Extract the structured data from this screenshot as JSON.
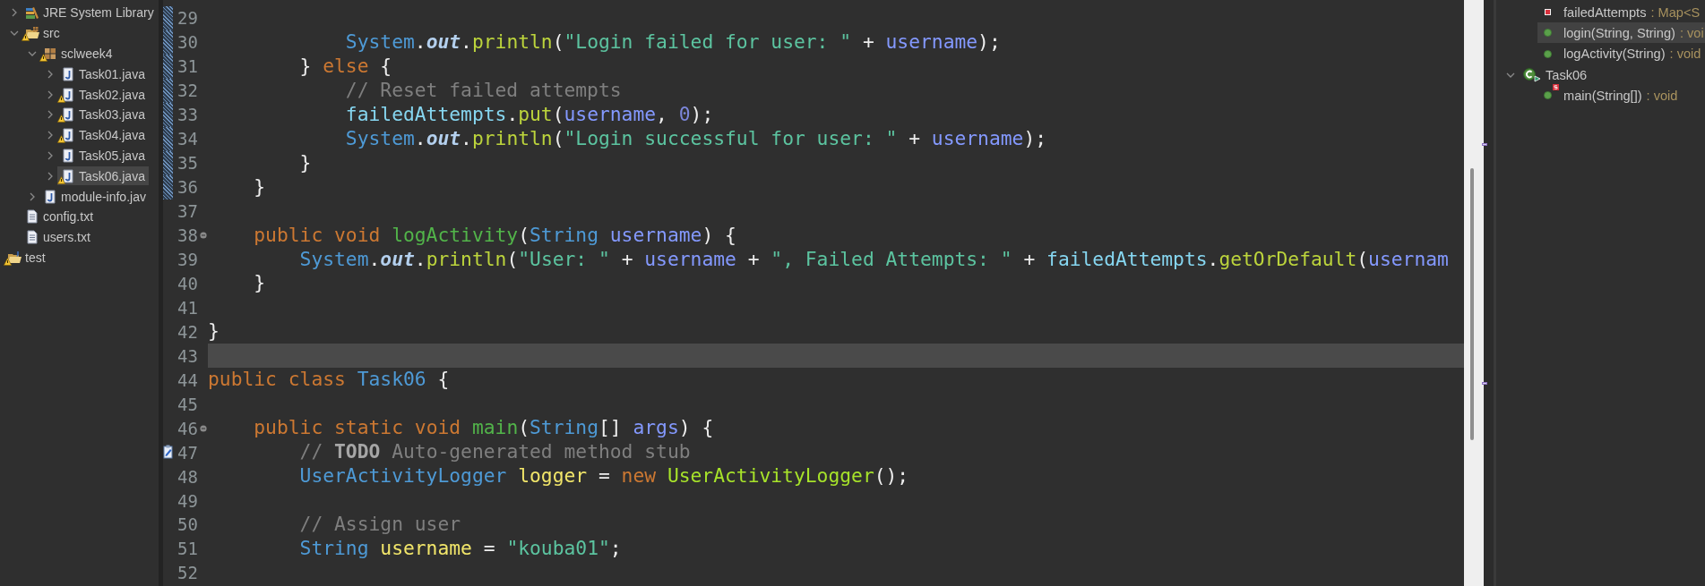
{
  "package_explorer": {
    "items": [
      {
        "label": "JRE System Library",
        "kind": "library",
        "expanded": false,
        "warning": false,
        "selected": false
      },
      {
        "label": "src",
        "kind": "source-folder",
        "expanded": true,
        "warning": true,
        "selected": false,
        "children": [
          {
            "label": "sclweek4",
            "kind": "package",
            "expanded": true,
            "warning": true,
            "selected": false,
            "children": [
              {
                "label": "Task01.java",
                "kind": "java-file",
                "expanded": false,
                "warning": false,
                "selected": false
              },
              {
                "label": "Task02.java",
                "kind": "java-file",
                "expanded": false,
                "warning": true,
                "selected": false
              },
              {
                "label": "Task03.java",
                "kind": "java-file",
                "expanded": false,
                "warning": true,
                "selected": false
              },
              {
                "label": "Task04.java",
                "kind": "java-file",
                "expanded": false,
                "warning": true,
                "selected": false
              },
              {
                "label": "Task05.java",
                "kind": "java-file",
                "expanded": false,
                "warning": false,
                "selected": false
              },
              {
                "label": "Task06.java",
                "kind": "java-file",
                "expanded": false,
                "warning": true,
                "selected": true
              }
            ]
          },
          {
            "label": "module-info.jav",
            "kind": "java-file",
            "expanded": false,
            "warning": false,
            "selected": false
          }
        ]
      },
      {
        "label": "config.txt",
        "kind": "text-file",
        "warning": false,
        "selected": false
      },
      {
        "label": "users.txt",
        "kind": "text-file",
        "warning": false,
        "selected": false
      },
      {
        "label": "test",
        "kind": "project",
        "warning": true,
        "selected": false
      }
    ]
  },
  "editor": {
    "lines": [
      {
        "number": "29",
        "kind": "plain",
        "changed": true,
        "current": false
      },
      {
        "number": "30",
        "kind": "plain",
        "changed": true,
        "current": false,
        "tokens": [
          {
            "text": "            System",
            "kind": "type"
          },
          {
            "text": ".",
            "kind": "plain"
          },
          {
            "text": "out",
            "kind": "static"
          },
          {
            "text": ".",
            "kind": "plain"
          },
          {
            "text": "println",
            "kind": "method"
          },
          {
            "text": "(",
            "kind": "plain"
          },
          {
            "text": "\"Login failed for user: \"",
            "kind": "string"
          },
          {
            "text": " + ",
            "kind": "plain"
          },
          {
            "text": "username",
            "kind": "param"
          },
          {
            "text": ");",
            "kind": "plain"
          }
        ]
      },
      {
        "number": "31",
        "kind": "plain",
        "changed": true,
        "current": false,
        "tokens": [
          {
            "text": "        } ",
            "kind": "plain"
          },
          {
            "text": "else",
            "kind": "keyword"
          },
          {
            "text": " {",
            "kind": "plain"
          }
        ]
      },
      {
        "number": "32",
        "kind": "plain",
        "changed": true,
        "current": false,
        "tokens": [
          {
            "text": "            // Reset failed attempts",
            "kind": "comment"
          }
        ]
      },
      {
        "number": "33",
        "kind": "plain",
        "changed": true,
        "current": false,
        "tokens": [
          {
            "text": "            failedAttempts",
            "kind": "field"
          },
          {
            "text": ".",
            "kind": "plain"
          },
          {
            "text": "put",
            "kind": "method"
          },
          {
            "text": "(",
            "kind": "plain"
          },
          {
            "text": "username",
            "kind": "param"
          },
          {
            "text": ", ",
            "kind": "plain"
          },
          {
            "text": "0",
            "kind": "number"
          },
          {
            "text": ");",
            "kind": "plain"
          }
        ]
      },
      {
        "number": "34",
        "kind": "plain",
        "changed": true,
        "current": false,
        "tokens": [
          {
            "text": "            System",
            "kind": "type"
          },
          {
            "text": ".",
            "kind": "plain"
          },
          {
            "text": "out",
            "kind": "static"
          },
          {
            "text": ".",
            "kind": "plain"
          },
          {
            "text": "println",
            "kind": "method"
          },
          {
            "text": "(",
            "kind": "plain"
          },
          {
            "text": "\"Login successful for user: \"",
            "kind": "string"
          },
          {
            "text": " + ",
            "kind": "plain"
          },
          {
            "text": "username",
            "kind": "param"
          },
          {
            "text": ");",
            "kind": "plain"
          }
        ]
      },
      {
        "number": "35",
        "kind": "plain",
        "changed": true,
        "current": false,
        "tokens": [
          {
            "text": "        }",
            "kind": "plain"
          }
        ]
      },
      {
        "number": "36",
        "kind": "plain",
        "changed": true,
        "current": false,
        "tokens": [
          {
            "text": "    }",
            "kind": "plain"
          }
        ]
      },
      {
        "number": "37",
        "kind": "plain",
        "changed": false,
        "current": false
      },
      {
        "number": "38",
        "kind": "fold",
        "changed": false,
        "current": false,
        "tokens": [
          {
            "text": "    public ",
            "kind": "keyword"
          },
          {
            "text": "void ",
            "kind": "keyword"
          },
          {
            "text": "logActivity",
            "kind": "method-declaration"
          },
          {
            "text": "(",
            "kind": "plain"
          },
          {
            "text": "String ",
            "kind": "type"
          },
          {
            "text": "username",
            "kind": "param"
          },
          {
            "text": ") {",
            "kind": "plain"
          }
        ]
      },
      {
        "number": "39",
        "kind": "plain",
        "changed": false,
        "current": false,
        "tokens": [
          {
            "text": "        System",
            "kind": "type"
          },
          {
            "text": ".",
            "kind": "plain"
          },
          {
            "text": "out",
            "kind": "static"
          },
          {
            "text": ".",
            "kind": "plain"
          },
          {
            "text": "println",
            "kind": "method"
          },
          {
            "text": "(",
            "kind": "plain"
          },
          {
            "text": "\"User: \"",
            "kind": "string"
          },
          {
            "text": " + ",
            "kind": "plain"
          },
          {
            "text": "username",
            "kind": "param"
          },
          {
            "text": " + ",
            "kind": "plain"
          },
          {
            "text": "\", Failed Attempts: \"",
            "kind": "string"
          },
          {
            "text": " + ",
            "kind": "plain"
          },
          {
            "text": "failedAttempts",
            "kind": "field"
          },
          {
            "text": ".",
            "kind": "plain"
          },
          {
            "text": "getOrDefault",
            "kind": "method"
          },
          {
            "text": "(",
            "kind": "plain"
          },
          {
            "text": "usernam",
            "kind": "param"
          }
        ]
      },
      {
        "number": "40",
        "kind": "plain",
        "changed": false,
        "current": false,
        "tokens": [
          {
            "text": "    }",
            "kind": "plain"
          }
        ]
      },
      {
        "number": "41",
        "kind": "plain",
        "changed": false,
        "current": false
      },
      {
        "number": "42",
        "kind": "plain",
        "changed": false,
        "current": false,
        "tokens": [
          {
            "text": "}",
            "kind": "plain"
          }
        ]
      },
      {
        "number": "43",
        "kind": "plain",
        "changed": false,
        "current": true
      },
      {
        "number": "44",
        "kind": "plain",
        "changed": false,
        "current": false,
        "tokens": [
          {
            "text": "public ",
            "kind": "keyword"
          },
          {
            "text": "class ",
            "kind": "keyword"
          },
          {
            "text": "Task06",
            "kind": "type"
          },
          {
            "text": " {",
            "kind": "plain"
          }
        ]
      },
      {
        "number": "45",
        "kind": "plain",
        "changed": false,
        "current": false
      },
      {
        "number": "46",
        "kind": "fold",
        "changed": false,
        "current": false,
        "tokens": [
          {
            "text": "    public ",
            "kind": "keyword"
          },
          {
            "text": "static ",
            "kind": "keyword"
          },
          {
            "text": "void ",
            "kind": "keyword"
          },
          {
            "text": "main",
            "kind": "method-declaration"
          },
          {
            "text": "(",
            "kind": "plain"
          },
          {
            "text": "String",
            "kind": "type"
          },
          {
            "text": "[] ",
            "kind": "plain"
          },
          {
            "text": "args",
            "kind": "param"
          },
          {
            "text": ") {",
            "kind": "plain"
          }
        ]
      },
      {
        "number": "47",
        "kind": "task",
        "changed": false,
        "current": false,
        "tokens": [
          {
            "text": "        // ",
            "kind": "comment"
          },
          {
            "text": "TODO",
            "kind": "todo"
          },
          {
            "text": " Auto-generated method stub",
            "kind": "comment"
          }
        ]
      },
      {
        "number": "48",
        "kind": "plain",
        "changed": false,
        "current": false,
        "tokens": [
          {
            "text": "        UserActivityLogger ",
            "kind": "type"
          },
          {
            "text": "logger",
            "kind": "local"
          },
          {
            "text": " = ",
            "kind": "plain"
          },
          {
            "text": "new ",
            "kind": "keyword"
          },
          {
            "text": "UserActivityLogger",
            "kind": "constructor"
          },
          {
            "text": "();",
            "kind": "plain"
          }
        ]
      },
      {
        "number": "49",
        "kind": "plain",
        "changed": false,
        "current": false
      },
      {
        "number": "50",
        "kind": "plain",
        "changed": false,
        "current": false,
        "tokens": [
          {
            "text": "        // Assign user",
            "kind": "comment"
          }
        ]
      },
      {
        "number": "51",
        "kind": "plain",
        "changed": false,
        "current": false,
        "tokens": [
          {
            "text": "        String ",
            "kind": "type"
          },
          {
            "text": "username",
            "kind": "local"
          },
          {
            "text": " = ",
            "kind": "plain"
          },
          {
            "text": "\"kouba01\"",
            "kind": "string"
          },
          {
            "text": ";",
            "kind": "plain"
          }
        ]
      },
      {
        "number": "52",
        "kind": "plain",
        "changed": false,
        "current": false
      }
    ]
  },
  "outline": {
    "items": [
      {
        "name": "failedAttempts",
        "detail": ": Map<S",
        "kind": "field",
        "static": false,
        "selected": false
      },
      {
        "name": "login(String, String)",
        "detail": ": voi",
        "kind": "method",
        "static": false,
        "selected": true
      },
      {
        "name": "logActivity(String)",
        "detail": ": void",
        "kind": "method",
        "static": false,
        "selected": false
      },
      {
        "name": "Task06",
        "kind": "class",
        "expanded": true,
        "selected": false,
        "children": [
          {
            "name": "main(String[])",
            "detail": ": void",
            "kind": "method",
            "static": true,
            "selected": false
          }
        ]
      }
    ]
  }
}
